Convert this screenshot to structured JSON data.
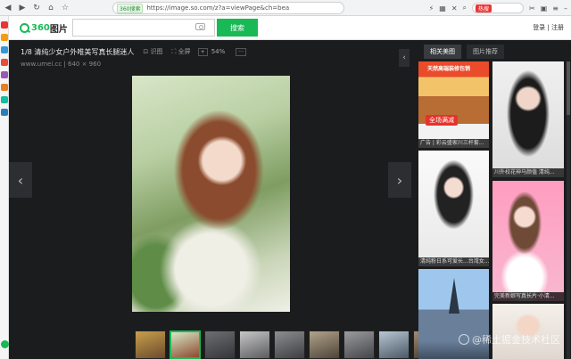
{
  "browser": {
    "secure_label": "360搜索",
    "url": "https://image.so.com/z?a=viewPage&ch=bea",
    "hot_label": "热搜",
    "search_placeholder": "搜索"
  },
  "header": {
    "logo_text": "360",
    "logo_suffix": "图片",
    "search_value": "",
    "search_button": "搜索",
    "login_label": "登录 | 注册"
  },
  "viewer": {
    "title": "1/8 清纯少女户外唯美写真长腿迷人",
    "toolbar": {
      "knowledge": "识图",
      "fullscreen": "全屏",
      "zoom_minus": "+",
      "zoom_value": "54%",
      "zoom_plus": "···"
    },
    "meta": "www.umei.cc | 640 × 960",
    "prev_arrow": "‹",
    "next_arrow": "›",
    "collapse_arrow": "‹"
  },
  "right_panel": {
    "tabs": [
      {
        "label": "相关美图"
      },
      {
        "label": "图片推荐"
      }
    ],
    "ad_top": "天然高端装修包销",
    "ad_badge": "全场满减",
    "captions": [
      "广告 | 彩云盛家川三杆套...",
      "川外校花神马颜值 清纯...",
      "清纯粉日系可爱长...台湾女...",
      "完美新娘写真长片·小清..."
    ]
  },
  "watermark": "@稀土掘金技术社区",
  "colors": {
    "accent": "#19b955",
    "viewer_bg": "#1b1c1e"
  }
}
